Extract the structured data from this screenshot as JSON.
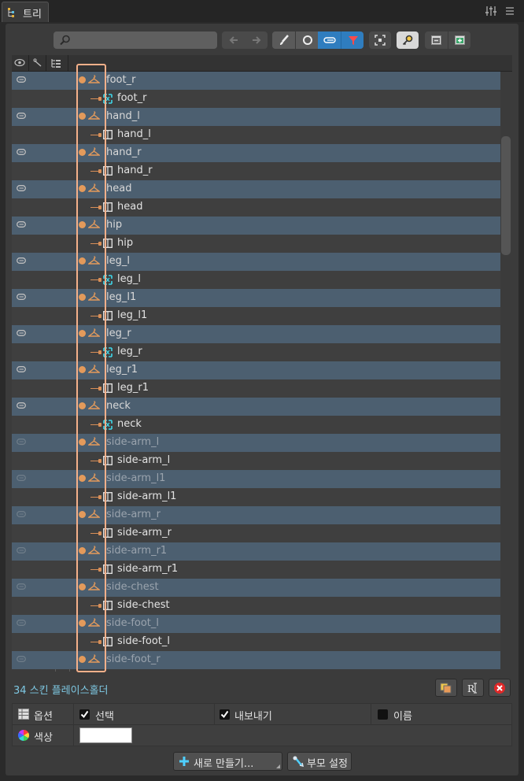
{
  "tab": {
    "title": "트리"
  },
  "search": {
    "value": "",
    "placeholder": ""
  },
  "tree": {
    "rows": [
      {
        "label": "foot_r",
        "kind": "slot",
        "visible": true
      },
      {
        "label": "foot_r",
        "kind": "attachment-weighted"
      },
      {
        "label": "hand_l",
        "kind": "slot",
        "visible": true
      },
      {
        "label": "hand_l",
        "kind": "attachment"
      },
      {
        "label": "hand_r",
        "kind": "slot",
        "visible": true
      },
      {
        "label": "hand_r",
        "kind": "attachment"
      },
      {
        "label": "head",
        "kind": "slot",
        "visible": true
      },
      {
        "label": "head",
        "kind": "attachment"
      },
      {
        "label": "hip",
        "kind": "slot",
        "visible": true
      },
      {
        "label": "hip",
        "kind": "attachment"
      },
      {
        "label": "leg_l",
        "kind": "slot",
        "visible": true
      },
      {
        "label": "leg_l",
        "kind": "attachment-weighted"
      },
      {
        "label": "leg_l1",
        "kind": "slot",
        "visible": true
      },
      {
        "label": "leg_l1",
        "kind": "attachment"
      },
      {
        "label": "leg_r",
        "kind": "slot",
        "visible": true
      },
      {
        "label": "leg_r",
        "kind": "attachment-weighted"
      },
      {
        "label": "leg_r1",
        "kind": "slot",
        "visible": true
      },
      {
        "label": "leg_r1",
        "kind": "attachment"
      },
      {
        "label": "neck",
        "kind": "slot",
        "visible": true
      },
      {
        "label": "neck",
        "kind": "attachment-weighted"
      },
      {
        "label": "side-arm_l",
        "kind": "slot",
        "visible": false
      },
      {
        "label": "side-arm_l",
        "kind": "attachment"
      },
      {
        "label": "side-arm_l1",
        "kind": "slot",
        "visible": false
      },
      {
        "label": "side-arm_l1",
        "kind": "attachment"
      },
      {
        "label": "side-arm_r",
        "kind": "slot",
        "visible": false
      },
      {
        "label": "side-arm_r",
        "kind": "attachment"
      },
      {
        "label": "side-arm_r1",
        "kind": "slot",
        "visible": false
      },
      {
        "label": "side-arm_r1",
        "kind": "attachment"
      },
      {
        "label": "side-chest",
        "kind": "slot",
        "visible": false
      },
      {
        "label": "side-chest",
        "kind": "attachment"
      },
      {
        "label": "side-foot_l",
        "kind": "slot",
        "visible": false
      },
      {
        "label": "side-foot_l",
        "kind": "attachment"
      },
      {
        "label": "side-foot_r",
        "kind": "slot",
        "visible": false
      }
    ]
  },
  "footer": {
    "count_text": "34 스킨 플레이스홀더",
    "options_label": "옵션",
    "select_label": "선택",
    "select_checked": true,
    "export_label": "내보내기",
    "export_checked": true,
    "name_label": "이름",
    "name_checked": false,
    "color_label": "색상",
    "color_value": "#ffffff",
    "new_button": "새로 만들기...",
    "set_parent_button": "부모 설정"
  },
  "colors": {
    "accent": "#2f7dbf",
    "row_blue": "#4c5f70",
    "highlight": "#f5b08a",
    "count_text": "#7ec8e3"
  }
}
